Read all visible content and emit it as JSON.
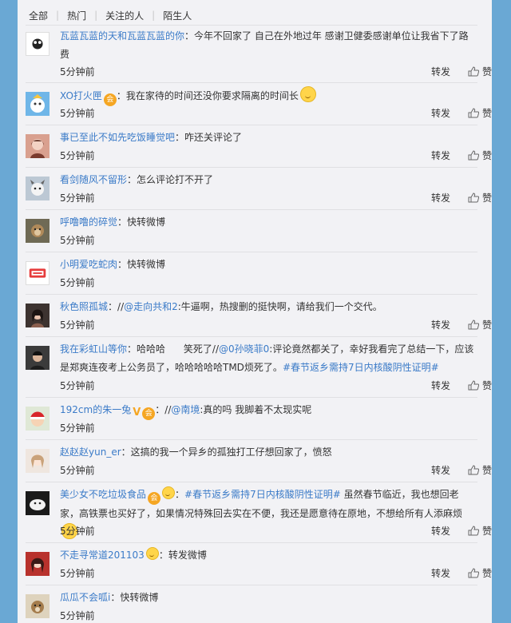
{
  "filters": [
    "全部",
    "热门",
    "关注的人",
    "陌生人"
  ],
  "actions": {
    "forward": "转发",
    "like": "赞"
  },
  "comments": [
    {
      "user": "瓦蓝瓦蓝的天和瓦蓝瓦蓝的你",
      "sep": "：",
      "text": "今年不回家了 自己在外地过年 感谢卫健委感谢单位让我省下了路费",
      "time": "5分钟前",
      "show_actions": true,
      "avatar": "panda-avatar"
    },
    {
      "user": "XO打火匣",
      "sep": "：",
      "text": "我在家待的时间还没你要求隔离的时间长",
      "time": "5分钟前",
      "show_actions": true,
      "avatar": "cartoon-avatar"
    },
    {
      "user": "事已至此不如先吃饭睡觉吧",
      "sep": "：",
      "text": "咋还关评论了",
      "time": "5分钟前",
      "show_actions": true,
      "avatar": "girl-avatar"
    },
    {
      "user": "看剑随风不留形",
      "sep": "：",
      "text": "怎么评论打不开了",
      "time": "5分钟前",
      "show_actions": true,
      "avatar": "dog-avatar"
    },
    {
      "user": "呼噜噜的碎觉",
      "sep": "：",
      "text": "快转微博",
      "time": "5分钟前",
      "show_actions": false,
      "avatar": "monkey-avatar"
    },
    {
      "user": "小明爱吃蛇肉",
      "sep": "：",
      "text": "快转微博",
      "time": "5分钟前",
      "show_actions": false,
      "avatar": "logo-avatar"
    },
    {
      "user": "秋色照孤城",
      "sep": "：",
      "text_prefix": "//",
      "mention": "@走向共和2",
      "text": ":牛逼啊，热搜删的挺快啊，请给我们一个交代。",
      "time": "5分钟前",
      "show_actions": true,
      "avatar": "woman-avatar"
    },
    {
      "user": "我在彩虹山等你",
      "sep": "：",
      "text_a": "哈哈哈      笑死了//",
      "mention": "@0孙晓菲0",
      "text_b": ":评论竟然都关了，幸好我看完了总结一下，应该是郑爽连夜考上公务员了，哈哈哈哈哈TMD烦死了。",
      "hashtag": "#春节返乡需持7日内核酸阴性证明#",
      "time": "5分钟前",
      "show_actions": true,
      "avatar": "man-avatar"
    },
    {
      "user": "192cm的朱一兔",
      "sep": "：",
      "text_prefix": "//",
      "mention": "@南境",
      "text": ":真的吗 我脚着不太现实呢",
      "time": "5分钟前",
      "show_actions": false,
      "avatar": "santa-avatar"
    },
    {
      "user": "赵赵赵yun_er",
      "sep": "：",
      "text": "这搞的我一个异乡的孤独打工仔想回家了，愤怒",
      "time": "5分钟前",
      "show_actions": true,
      "avatar": "anime-avatar"
    },
    {
      "user": "美少女不吃垃圾食品",
      "sep": "：",
      "hashtag": "#春节返乡需持7日内核酸阴性证明#",
      "text": " 虽然春节临近，我也想回老家，高铁票也买好了，如果情况特殊回去实在不便，我还是愿意待在原地，不想给所有人添麻烦",
      "time": "5分钟前",
      "show_actions": true,
      "avatar": "cat-avatar"
    },
    {
      "user": "不走寻常道201103",
      "sep": "：",
      "text": "转发微博",
      "time": "5分钟前",
      "show_actions": true,
      "avatar": "girl2-avatar"
    },
    {
      "user": "瓜瓜不会呱i",
      "sep": "：",
      "text": "快转微博",
      "time": "5分钟前",
      "show_actions": false,
      "avatar": "puppy-avatar"
    }
  ],
  "colors": {
    "link": "#3b7bc8",
    "background": "#6aa8d4",
    "panel": "#f2f2f5"
  }
}
